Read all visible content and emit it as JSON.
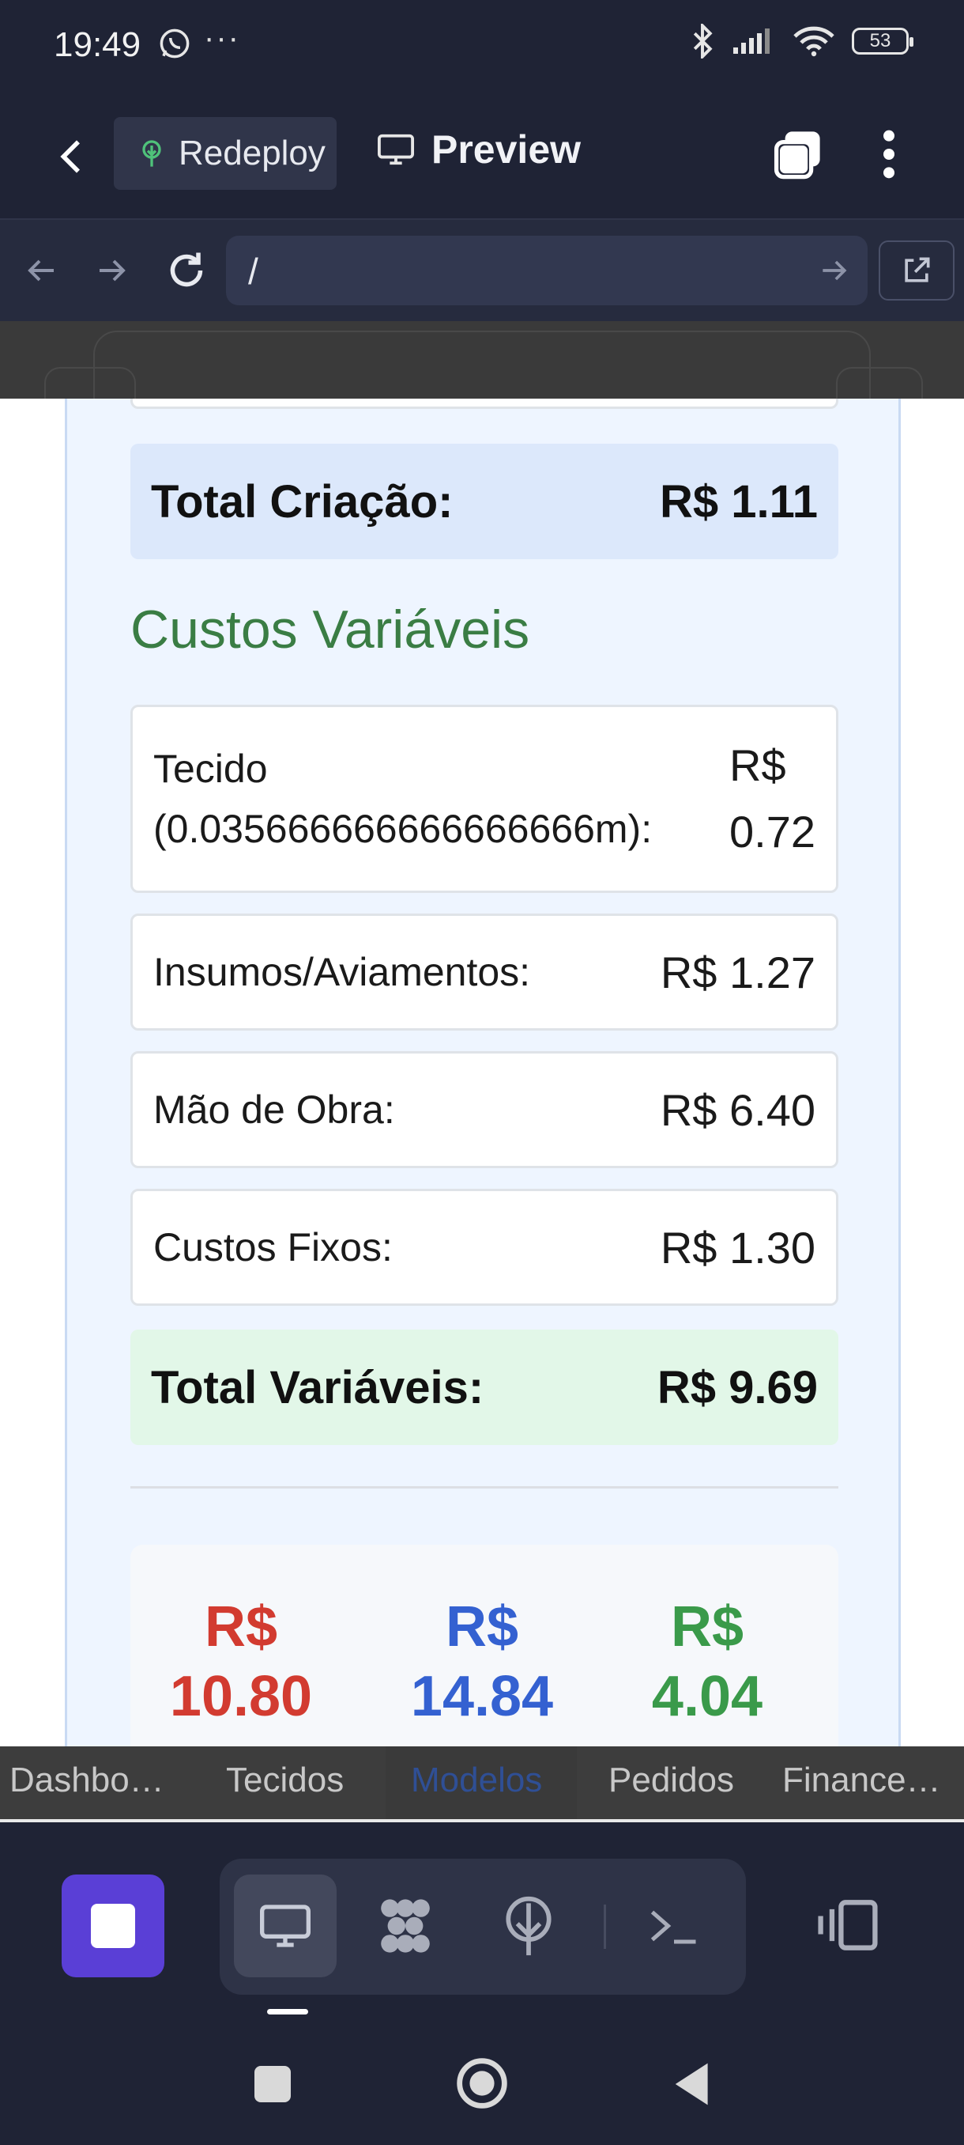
{
  "status_bar": {
    "time": "19:49",
    "extra": "···",
    "battery": "53"
  },
  "app_bar": {
    "redeploy_label": "Redeploy",
    "preview_label": "Preview"
  },
  "browser": {
    "url": "/"
  },
  "page": {
    "creation_total": {
      "label": "Total Criação:",
      "value": "R$ 1.11"
    },
    "variable_costs": {
      "title": "Custos Variáveis",
      "items": [
        {
          "label_line1": "Tecido",
          "label_line2": "(0.035666666666666666m):",
          "value_line1": "R$",
          "value_line2": "0.72"
        },
        {
          "label": "Insumos/Aviamentos:",
          "value": "R$ 1.27"
        },
        {
          "label": "Mão de Obra:",
          "value": "R$ 6.40"
        },
        {
          "label": "Custos Fixos:",
          "value": "R$ 1.30"
        }
      ],
      "total": {
        "label": "Total Variáveis:",
        "value": "R$ 9.69"
      }
    },
    "summary": [
      {
        "currency": "R$",
        "amount": "10.80",
        "color": "#d23b30"
      },
      {
        "currency": "R$",
        "amount": "14.84",
        "color": "#3461d1"
      },
      {
        "currency": "R$",
        "amount": "4.04",
        "color": "#3a9a4a"
      }
    ]
  },
  "web_tabs": [
    "Dashbo…",
    "Tecidos",
    "Modelos",
    "Pedidos",
    "Finance…"
  ],
  "web_tabs_active": "Modelos",
  "colors": {
    "accent_green": "#3a7d44",
    "accent_purple": "#5a3fd6",
    "total_creation_bg": "#dce8fb",
    "total_variable_bg": "#e2f7e8"
  },
  "icons": {
    "status": [
      "whatsapp-icon",
      "bluetooth-icon",
      "signal-icon",
      "wifi-icon",
      "battery-icon"
    ],
    "toolbar": [
      "stop-icon",
      "desktop-icon",
      "apps-icon",
      "deploy-icon",
      "terminal-icon",
      "split-view-icon"
    ]
  }
}
